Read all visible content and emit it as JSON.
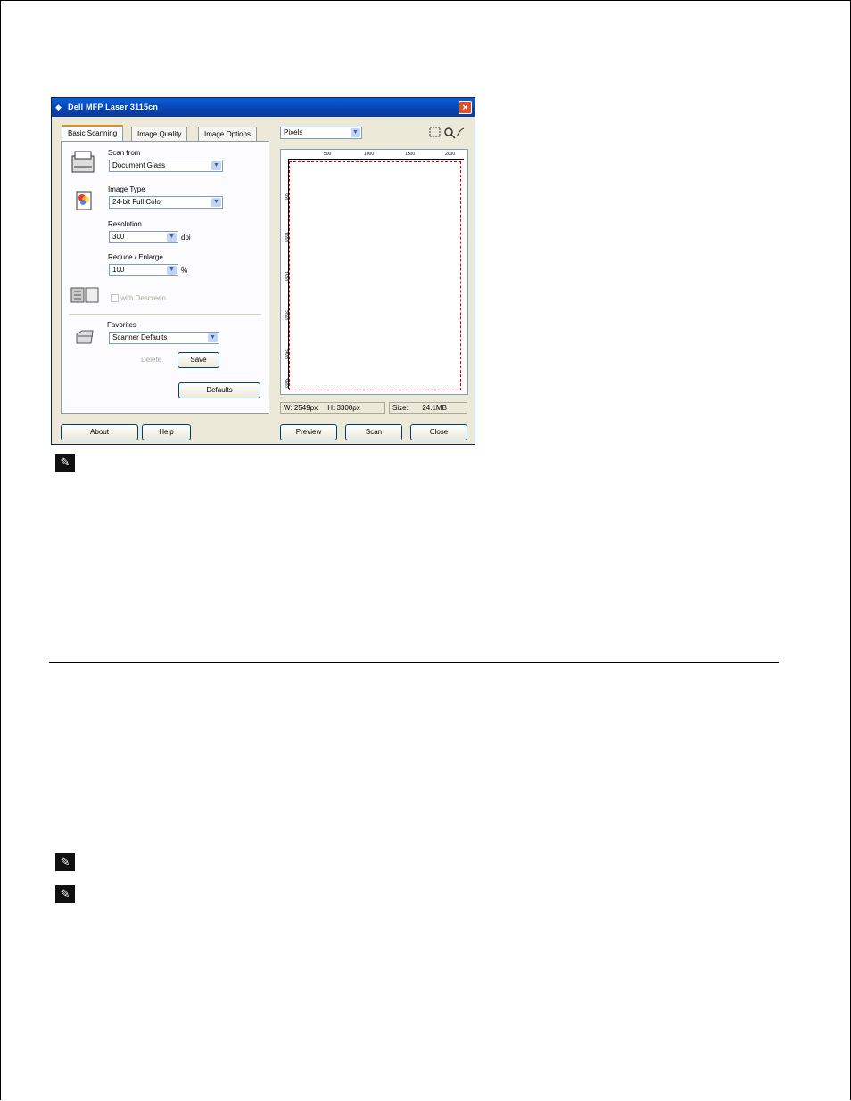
{
  "dialog": {
    "title": "Dell MFP Laser 3115cn",
    "app_icon": "dell-icon",
    "close_icon": "close-icon",
    "tabs": [
      "Basic Scanning",
      "Image Quality",
      "Image Options"
    ],
    "scan_from": {
      "label": "Scan from",
      "value": "Document Glass"
    },
    "image_type": {
      "label": "Image Type",
      "value": "24-bit Full Color"
    },
    "resolution": {
      "label": "Resolution",
      "value": "300",
      "unit": "dpi"
    },
    "reduce_enlarge": {
      "label": "Reduce / Enlarge",
      "value": "100",
      "unit": "%"
    },
    "descreen": {
      "label": "with Descreen"
    },
    "favorites": {
      "label": "Favorites",
      "value": "Scanner Defaults",
      "delete_label": "Delete",
      "save_label": "Save"
    },
    "defaults_label": "Defaults",
    "about_label": "About",
    "help_label": "Help",
    "units": {
      "value": "Pixels"
    },
    "ruler_top": [
      "500",
      "1000",
      "1500",
      "2000"
    ],
    "ruler_left": [
      "500",
      "1000",
      "1500",
      "2000",
      "2500",
      "3000"
    ],
    "status": {
      "width": "W: 2549px",
      "height": "H: 3300px",
      "size_label": "Size:",
      "size_value": "24.1MB"
    },
    "preview_label": "Preview",
    "scan_label": "Scan",
    "close_label": "Close",
    "accent_color": "#0a5fd8"
  },
  "notes": [
    "note-icon",
    "note-icon",
    "note-icon"
  ]
}
